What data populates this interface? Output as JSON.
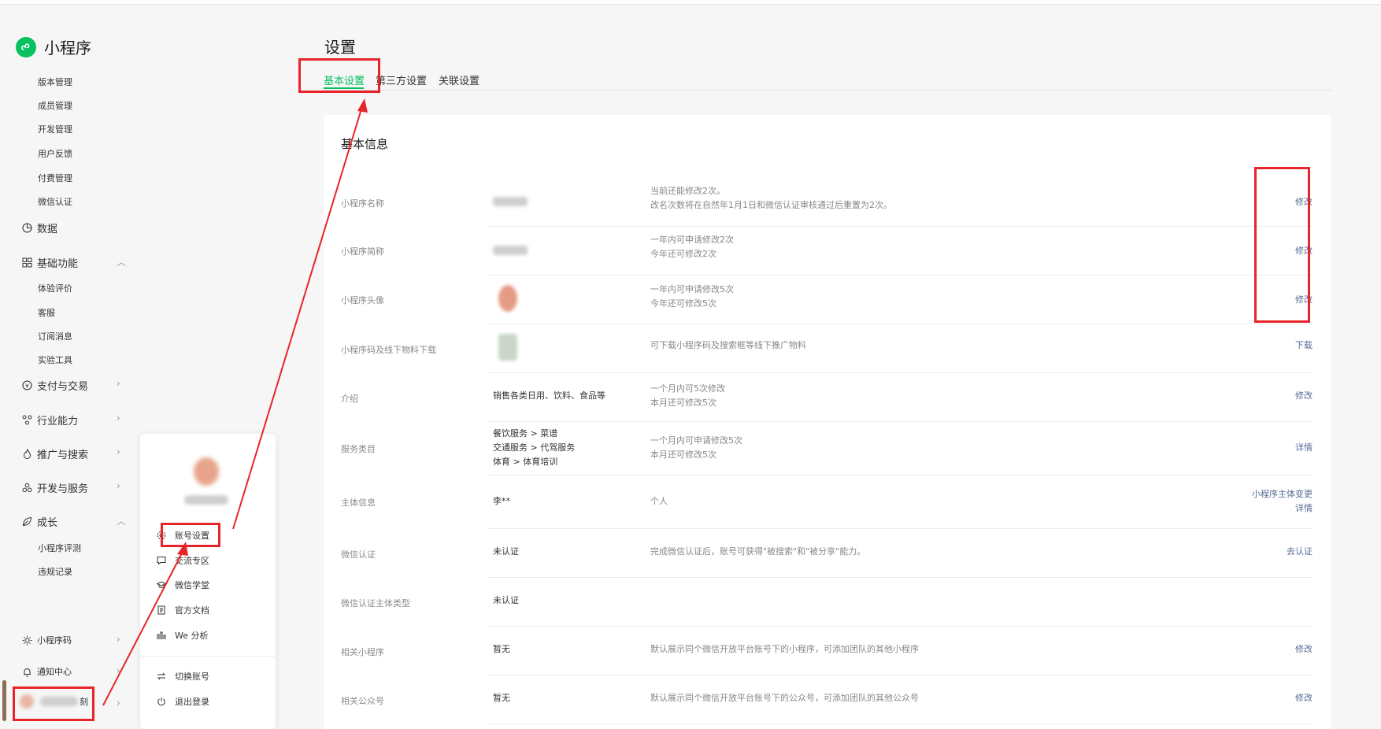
{
  "app": {
    "title": "小程序"
  },
  "sidebar": {
    "group1": [
      "版本管理",
      "成员管理",
      "开发管理",
      "用户反馈",
      "付费管理",
      "微信认证"
    ],
    "data_label": "数据",
    "basic_label": "基础功能",
    "basic_items": [
      "体验评价",
      "客服",
      "订阅消息",
      "实验工具"
    ],
    "pay_label": "支付与交易",
    "industry_label": "行业能力",
    "promo_label": "推广与搜索",
    "dev_label": "开发与服务",
    "growth_label": "成长",
    "growth_items": [
      "小程序评测",
      "违规记录"
    ],
    "qrcode_label": "小程序码",
    "notify_label": "通知中心",
    "user_suffix": "刻"
  },
  "popup": {
    "items": [
      "账号设置",
      "交流专区",
      "微信学堂",
      "官方文档",
      "We 分析"
    ],
    "switch_label": "切换账号",
    "logout_label": "退出登录"
  },
  "page": {
    "title": "设置",
    "tabs": [
      "基本设置",
      "第三方设置",
      "关联设置"
    ],
    "section_title": "基本信息"
  },
  "rows": [
    {
      "label": "小程序名称",
      "value": "",
      "hint1": "当前还能修改2次。",
      "hint2": "改名次数将在自然年1月1日和微信认证审核通过后重置为2次。",
      "action": "修改"
    },
    {
      "label": "小程序简称",
      "value": "",
      "hint1": "一年内可申请修改2次",
      "hint2": "今年还可修改2次",
      "action": "修改"
    },
    {
      "label": "小程序头像",
      "value": "",
      "hint1": "一年内可申请修改5次",
      "hint2": "今年还可修改5次",
      "action": "修改"
    },
    {
      "label": "小程序码及线下物料下载",
      "value": "",
      "hint1": "可下载小程序码及搜索框等线下推广物料",
      "hint2": "",
      "action": "下载"
    },
    {
      "label": "介绍",
      "value": "销售各类日用、饮料、食品等",
      "hint1": "一个月内可5次修改",
      "hint2": "本月还可修改5次",
      "action": "修改"
    },
    {
      "label": "服务类目",
      "value1": "餐饮服务 > 菜谱",
      "value2": "交通服务 > 代驾服务",
      "value3": "体育 > 体育培训",
      "hint1": "一个月内可申请修改5次",
      "hint2": "本月还可修改5次",
      "action": "详情"
    },
    {
      "label": "主体信息",
      "value": "李**",
      "hint1": "个人",
      "hint2": "",
      "action": "小程序主体变更",
      "action2": "详情"
    },
    {
      "label": "微信认证",
      "value": "未认证",
      "hint1": "完成微信认证后，账号可获得\"被搜索\"和\"被分享\"能力。",
      "hint2": "",
      "action": "去认证"
    },
    {
      "label": "微信认证主体类型",
      "value": "未认证",
      "hint1": "",
      "hint2": "",
      "action": ""
    },
    {
      "label": "相关小程序",
      "value": "暂无",
      "hint1": "默认展示同个微信开放平台账号下的小程序，可添加团队的其他小程序",
      "hint2": "",
      "action": "修改"
    },
    {
      "label": "相关公众号",
      "value": "暂无",
      "hint1": "默认展示同个微信开放平台账号下的公众号，可添加团队的其他公众号",
      "hint2": "",
      "action": "修改"
    }
  ],
  "colors": {
    "accent": "#07c160",
    "link": "#576b95",
    "annotation": "#e8242b"
  }
}
